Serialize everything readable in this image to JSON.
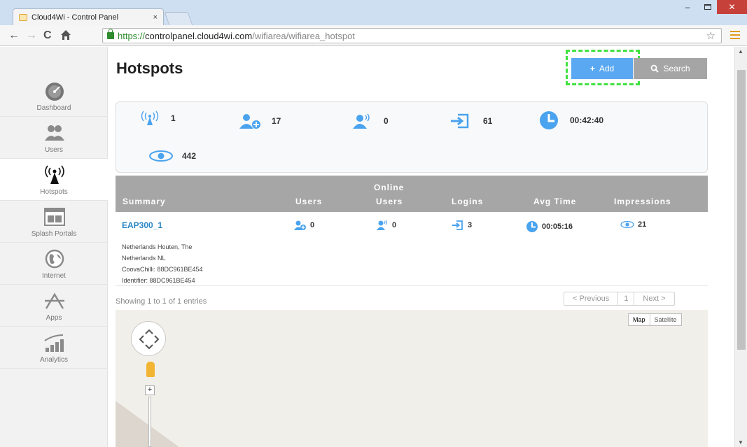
{
  "browser": {
    "tab_title": "Cloud4Wi - Control Panel",
    "tab_close": "×",
    "url_scheme": "https://",
    "url_host": "controlpanel.cloud4wi.com",
    "url_path": "/wifiarea/wifiarea_hotspot"
  },
  "sidebar": {
    "items": [
      {
        "label": "Dashboard",
        "icon": "dashboard-gauge-icon"
      },
      {
        "label": "Users",
        "icon": "users-icon"
      },
      {
        "label": "Hotspots",
        "icon": "hotspot-antenna-icon"
      },
      {
        "label": "Splash Portals",
        "icon": "splash-portal-icon"
      },
      {
        "label": "Internet",
        "icon": "globe-icon"
      },
      {
        "label": "Apps",
        "icon": "apps-icon"
      },
      {
        "label": "Analytics",
        "icon": "analytics-bars-icon"
      }
    ]
  },
  "header": {
    "title": "Hotspots",
    "add_label": "Add",
    "search_label": "Search"
  },
  "stats": {
    "hotspots": "1",
    "new_users": "17",
    "online_users": "0",
    "logins": "61",
    "avg_time": "00:42:40",
    "impressions": "442"
  },
  "table": {
    "headers": {
      "summary": "Summary",
      "users": "Users",
      "online_1": "Online",
      "online_2": "Users",
      "logins": "Logins",
      "avg_time": "Avg Time",
      "impressions": "Impressions"
    },
    "rows": [
      {
        "name": "EAP300_1",
        "users": "0",
        "online_users": "0",
        "logins": "3",
        "avg_time": "00:05:16",
        "impressions": "21",
        "details": [
          "Netherlands Houten, The",
          "Netherlands NL",
          "CoovaChilli: 88DC961BE454",
          "Identifier: 88DC961BE454"
        ]
      }
    ]
  },
  "footer": {
    "entries": "Showing 1 to 1 of 1 entries",
    "prev": "< Previous",
    "page": "1",
    "next": "Next >"
  },
  "map": {
    "map_label": "Map",
    "satellite_label": "Satellite"
  },
  "colors": {
    "accent_blue": "#5aa8f2",
    "link_blue": "#2a86c6",
    "highlight_green": "#3fe23f",
    "table_header": "#a6a6a6"
  }
}
